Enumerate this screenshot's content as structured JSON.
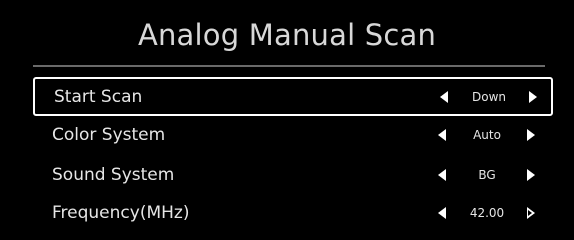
{
  "screen": {
    "title": "Analog Manual Scan"
  },
  "menu": {
    "items": [
      {
        "label": "Start Scan",
        "value": "Down",
        "selected": true
      },
      {
        "label": "Color System",
        "value": "Auto",
        "selected": false
      },
      {
        "label": "Sound System",
        "value": "BG",
        "selected": false
      },
      {
        "label": "Frequency(MHz)",
        "value": "42.00",
        "selected": false
      }
    ]
  },
  "icons": {
    "decrease": "triangle-left-icon",
    "increase": "triangle-right-icon"
  },
  "colors": {
    "background": "#000000",
    "text": "#e6e6e6",
    "selection_border": "#ffffff"
  }
}
